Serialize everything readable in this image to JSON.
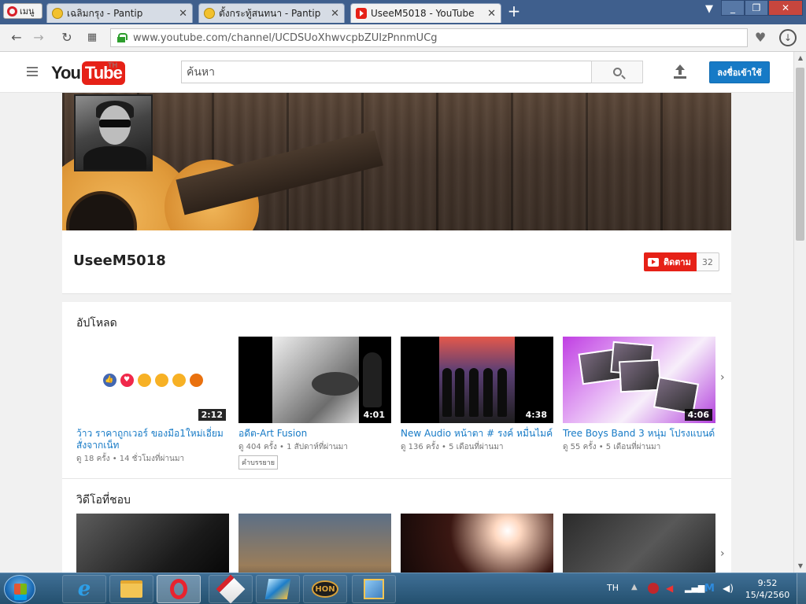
{
  "browser": {
    "menu_label": "เมนู",
    "tabs": [
      {
        "title": "เฉลิมกรุง - Pantip",
        "active": false
      },
      {
        "title": "ตั้งกระทู้สนทนา - Pantip",
        "active": false
      },
      {
        "title": "UseeM5018 - YouTube",
        "active": true
      }
    ],
    "url": "www.youtube.com/channel/UCDSUoXhwvcpbZUIzPnnmUCg"
  },
  "youtube": {
    "logo_you": "You",
    "logo_tube": "Tube",
    "country_code": "TH",
    "search_placeholder": "ค้นหา",
    "signin_label": "ลงชื่อเข้าใช้"
  },
  "channel": {
    "name": "UseeM5018",
    "subscribe_label": "ติดตาม",
    "subscriber_count": "32"
  },
  "uploads": {
    "title": "อัปโหลด",
    "videos": [
      {
        "title": "ว้าว ราคาถูกเวอร์ ของมือ1ใหม่เอี่ยม สั่งจากเน็ท",
        "duration": "2:12",
        "meta": "ดู 18 ครั้ง • 14 ชั่วโมงที่ผ่านมา",
        "badge": ""
      },
      {
        "title": "อดีต-Art Fusion",
        "duration": "4:01",
        "meta": "ดู 404 ครั้ง • 1 สัปดาห์ที่ผ่านมา",
        "badge": "คำบรรยาย"
      },
      {
        "title": "New Audio หน้าตา # รงค์ หมื่นไมค์",
        "duration": "4:38",
        "meta": "ดู 136 ครั้ง • 5 เดือนที่ผ่านมา",
        "badge": ""
      },
      {
        "title": "Tree Boys Band 3 หนุ่ม โปรงแบนด์",
        "duration": "4:06",
        "meta": "ดู 55 ครั้ง • 5 เดือนที่ผ่านมา",
        "badge": ""
      }
    ]
  },
  "liked": {
    "title": "วิดีโอที่ชอบ"
  },
  "taskbar": {
    "language": "TH",
    "hon_label": "HON",
    "time": "9:52",
    "date": "15/4/2560"
  },
  "colors": {
    "youtube_red": "#e62117",
    "link_blue": "#167ac6",
    "signin_blue": "#167ac6"
  }
}
